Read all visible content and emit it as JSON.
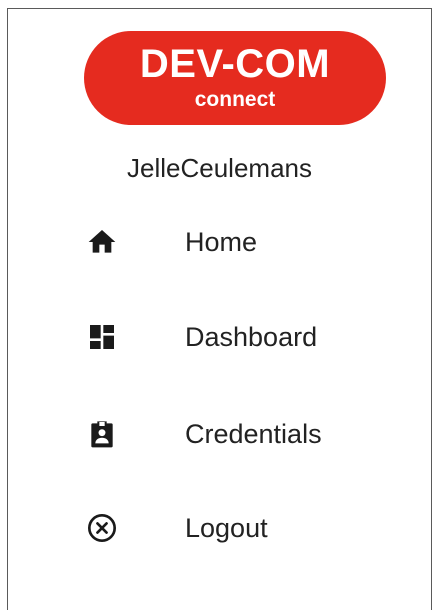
{
  "logo": {
    "main": "DEV-COM",
    "sub": "connect",
    "color": "#e52b1f"
  },
  "user": {
    "name": "JelleCeulemans"
  },
  "nav": {
    "items": [
      {
        "label": "Home",
        "icon": "home-icon"
      },
      {
        "label": "Dashboard",
        "icon": "dashboard-icon"
      },
      {
        "label": "Credentials",
        "icon": "badge-icon"
      },
      {
        "label": "Logout",
        "icon": "close-circle-icon"
      }
    ]
  }
}
